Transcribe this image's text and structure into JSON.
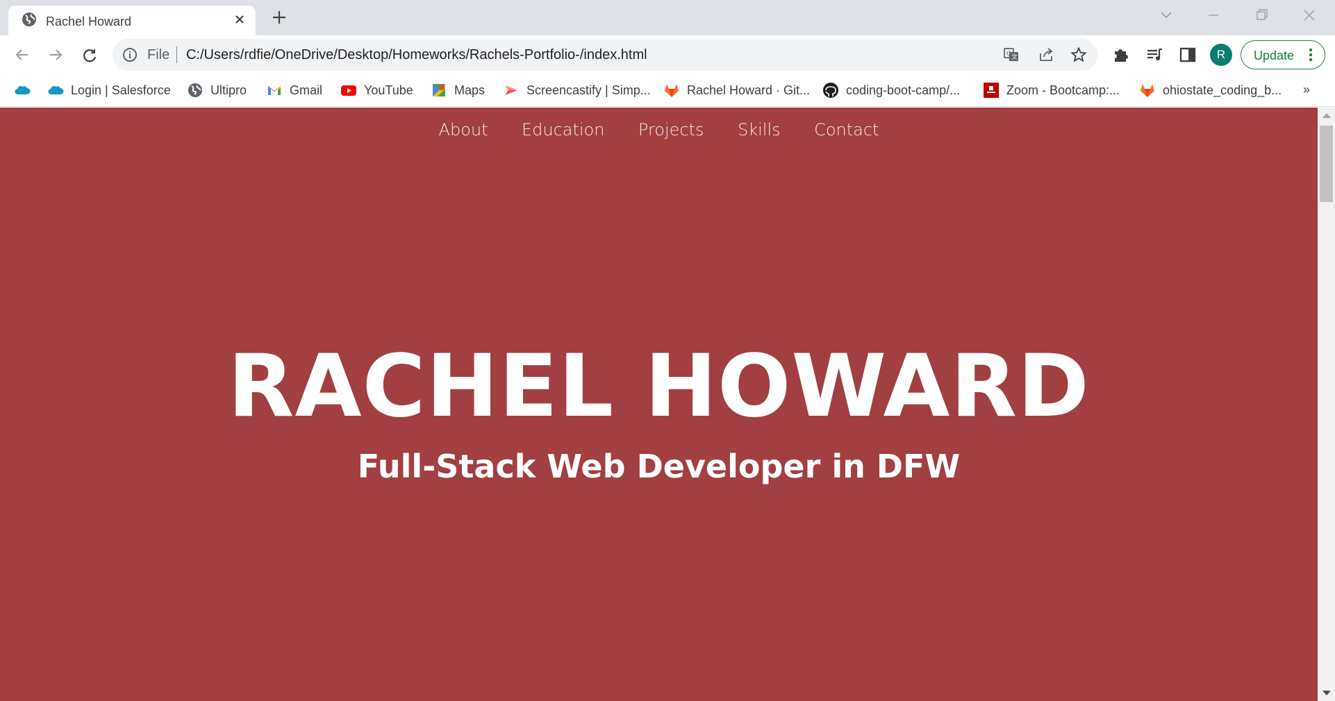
{
  "browser": {
    "tab": {
      "title": "Rachel Howard",
      "favicon": "globe-icon"
    },
    "address_bar": {
      "scheme_label": "File",
      "url": "C:/Users/rdfie/OneDrive/Desktop/Homeworks/Rachels-Portfolio-/index.html"
    },
    "profile_initial": "R",
    "update_label": "Update",
    "accent_color": "#188038"
  },
  "bookmarks": {
    "items": [
      {
        "label": "",
        "icon": "salesforce-cloud-icon"
      },
      {
        "label": "Login | Salesforce",
        "icon": "salesforce-cloud-icon"
      },
      {
        "label": "Ultipro",
        "icon": "globe-icon"
      },
      {
        "label": "Gmail",
        "icon": "gmail-icon"
      },
      {
        "label": "YouTube",
        "icon": "youtube-icon"
      },
      {
        "label": "Maps",
        "icon": "maps-icon"
      },
      {
        "label": "Screencastify | Simp...",
        "icon": "screencastify-icon"
      },
      {
        "label": "Rachel Howard · Git...",
        "icon": "gitlab-icon"
      },
      {
        "label": "coding-boot-camp/...",
        "icon": "github-icon"
      },
      {
        "label": "Zoom - Bootcamp:...",
        "icon": "zoom-bootcamp-icon"
      },
      {
        "label": "ohiostate_coding_b...",
        "icon": "gitlab-icon"
      }
    ],
    "more": "»"
  },
  "page": {
    "background_color": "#a13f42",
    "nav": [
      "About",
      "Education",
      "Projects",
      "Skills",
      "Contact"
    ],
    "hero": {
      "name": "RACHEL HOWARD",
      "subtitle": "Full-Stack Web Developer in DFW"
    }
  }
}
